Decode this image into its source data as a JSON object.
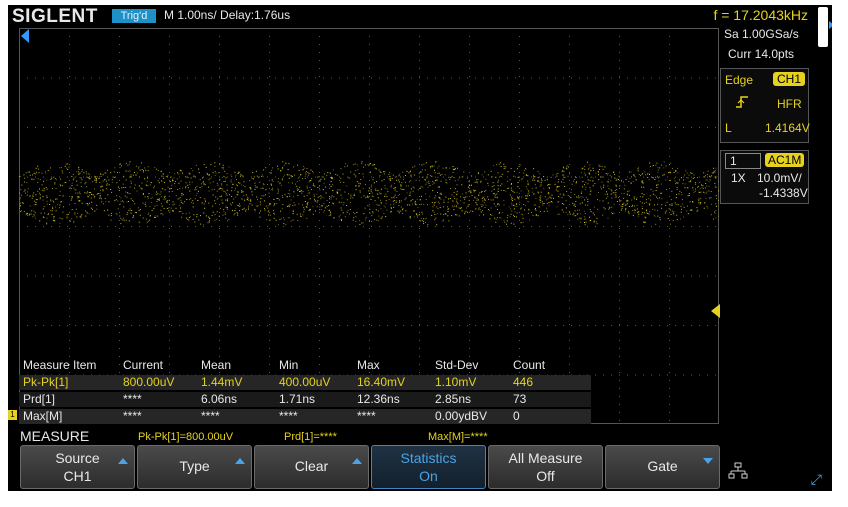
{
  "header": {
    "brand": "SIGLENT",
    "trigger_status": "Trig'd",
    "timebase": "M 1.00ns/  Delay:1.76us",
    "frequency": "f = 17.2043kHz"
  },
  "acquisition": {
    "sample_rate": "Sa 1.00GSa/s",
    "memory": "Curr 14.0pts"
  },
  "trigger": {
    "type": "Edge",
    "source": "CH1",
    "coupling": "HFR",
    "level_label": "L",
    "level": "1.4164V"
  },
  "channel1": {
    "number": "1",
    "coupling": "AC1M",
    "probe": "1X",
    "scale": "10.0mV/",
    "offset": "-1.4338V"
  },
  "measure_table": {
    "headers": [
      "Measure Item",
      "Current",
      "Mean",
      "Min",
      "Max",
      "Std-Dev",
      "Count"
    ],
    "rows": [
      [
        "Pk-Pk[1]",
        "800.00uV",
        "1.44mV",
        "400.00uV",
        "16.40mV",
        "1.10mV",
        "446"
      ],
      [
        "Prd[1]",
        "****",
        "6.06ns",
        "1.71ns",
        "12.36ns",
        "2.85ns",
        "73"
      ],
      [
        "Max[M]",
        "****",
        "****",
        "****",
        "****",
        "0.00ydBV",
        "0"
      ]
    ]
  },
  "measure_bar": {
    "title": "MEASURE",
    "items": [
      "Pk-Pk[1]=800.00uV",
      "Prd[1]=****",
      "Max[M]=****"
    ]
  },
  "softkeys": [
    {
      "line1": "Source",
      "line2": "CH1",
      "active": false,
      "arrow": "up"
    },
    {
      "line1": "Type",
      "line2": "",
      "active": false,
      "arrow": "up"
    },
    {
      "line1": "Clear",
      "line2": "",
      "active": false,
      "arrow": "up"
    },
    {
      "line1": "Statistics",
      "line2": "On",
      "active": true,
      "arrow": ""
    },
    {
      "line1": "All Measure",
      "line2": "Off",
      "active": false,
      "arrow": ""
    },
    {
      "line1": "Gate",
      "line2": "",
      "active": false,
      "arrow": "down"
    }
  ],
  "colors": {
    "channel1": "#e6d21e",
    "accent": "#3399ff",
    "background": "#000000"
  }
}
